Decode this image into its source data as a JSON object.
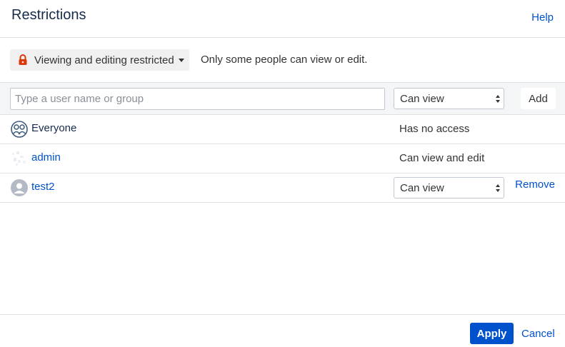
{
  "dialog": {
    "title": "Restrictions",
    "help_label": "Help"
  },
  "mode": {
    "label": "Viewing and editing restricted",
    "description": "Only some people can view or edit.",
    "icon": "lock-icon",
    "icon_color": "#de350b"
  },
  "add_form": {
    "placeholder": "Type a user name or group",
    "value": "",
    "permission": "Can view",
    "add_label": "Add"
  },
  "entries": [
    {
      "name": "Everyone",
      "access": "Has no access",
      "avatar": "group-avatar-icon"
    },
    {
      "name": "admin",
      "access": "Can view and edit",
      "avatar": "user-avatar-image"
    },
    {
      "name": "test2",
      "access": "Can view",
      "avatar": "default-user-avatar-icon",
      "remove_label": "Remove"
    }
  ],
  "footer": {
    "apply_label": "Apply",
    "cancel_label": "Cancel"
  },
  "colors": {
    "primary": "#0052cc",
    "text": "#172b4d",
    "border": "#dfe1e6"
  }
}
